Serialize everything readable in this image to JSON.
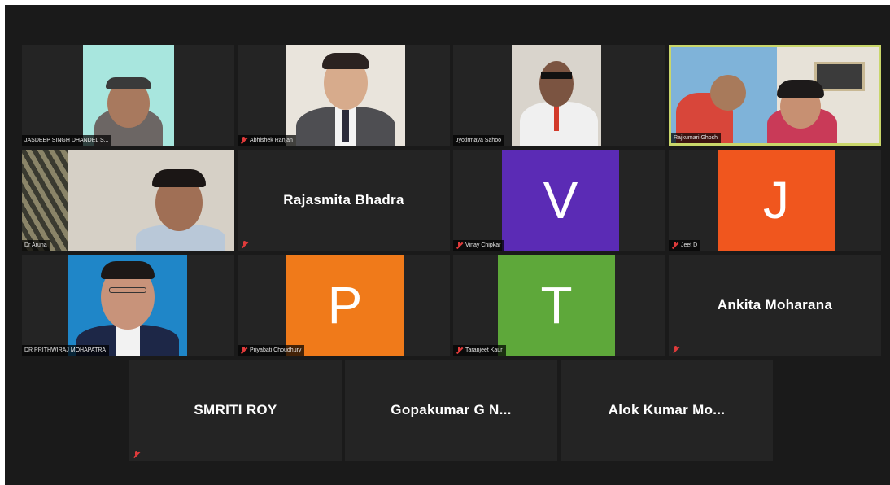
{
  "participants": [
    {
      "name_tag": "JASDEEP SINGH DHANDEL S..."
    },
    {
      "name_tag": "Abhishek Ranjan"
    },
    {
      "name_tag": "Jyotirmaya Sahoo"
    },
    {
      "name_tag": "Rajkumari Ghosh"
    },
    {
      "name_tag": "Dr Aruna"
    },
    {
      "display_name": "Rajasmita Bhadra"
    },
    {
      "avatar_letter": "V",
      "avatar_color": "#5b2bb5",
      "name_tag": "Vinay Chipkar"
    },
    {
      "avatar_letter": "J",
      "avatar_color": "#f0561e",
      "name_tag": "Jeet D"
    },
    {
      "name_tag": "DR PRITHWIRAJ MOHAPATRA"
    },
    {
      "avatar_letter": "P",
      "avatar_color": "#f07a1a",
      "name_tag": "Priyabati Choudhury"
    },
    {
      "avatar_letter": "T",
      "avatar_color": "#5ea83a",
      "name_tag": "Taranjeet Kaur"
    },
    {
      "display_name": "Ankita Moharana"
    },
    {
      "display_name": "SMRITI ROY"
    },
    {
      "display_name": "Gopakumar G N..."
    },
    {
      "display_name": "Alok Kumar Mo..."
    }
  ],
  "colors": {
    "background": "#1a1a1a",
    "tile": "#242424",
    "active_speaker_border": "#c9d66a",
    "muted_mic": "#e03b3b"
  }
}
